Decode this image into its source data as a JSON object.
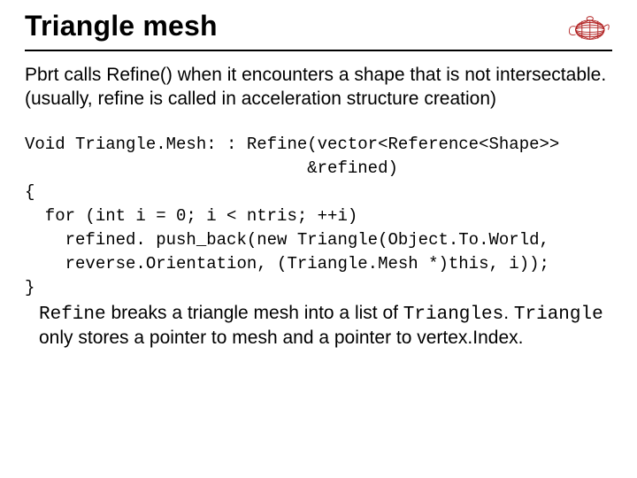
{
  "title": "Triangle mesh",
  "intro": "Pbrt calls Refine() when it encounters a shape that is not intersectable. (usually, refine is called in acceleration structure creation)",
  "code": "Void Triangle.Mesh: : Refine(vector<Reference<Shape>>\n                            &refined)\n{\n  for (int i = 0; i < ntris; ++i)\n    refined. push_back(new Triangle(Object.To.World,\n    reverse.Orientation, (Triangle.Mesh *)this, i));\n}",
  "note": {
    "w1": "Refine",
    "t1": " breaks a triangle mesh into a list of ",
    "w2": "Triangles",
    "t2": ". ",
    "w3": "Triangle",
    "t3": " only stores a pointer to mesh and a pointer to vertex.Index."
  },
  "logo": {
    "name": "teapot-icon",
    "stroke": "#b02020"
  }
}
